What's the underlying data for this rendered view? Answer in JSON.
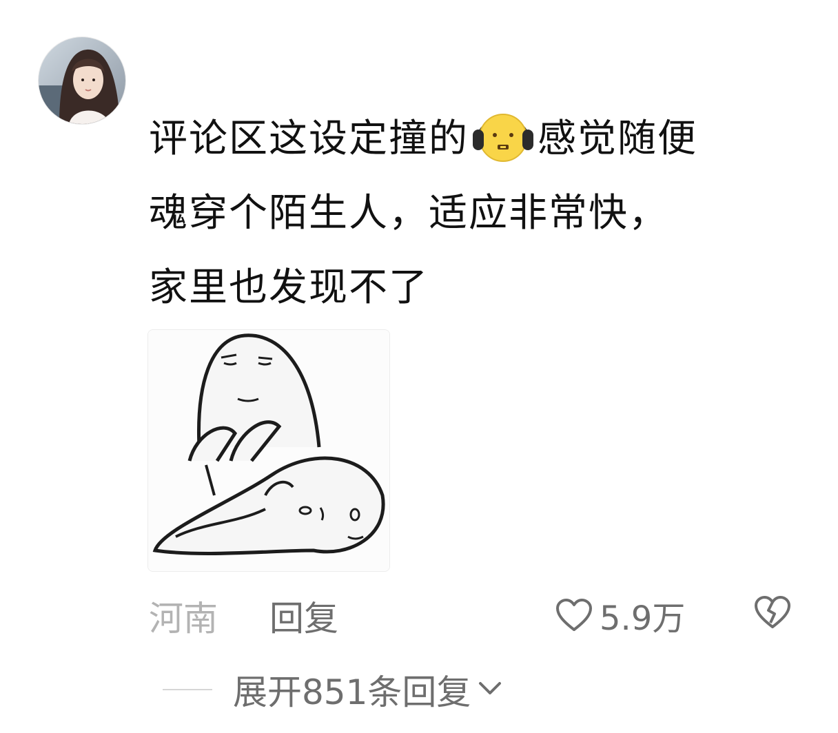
{
  "comment": {
    "avatar_icon": "user-avatar",
    "text": {
      "line1_before_emoji": "评论区这设定撞的",
      "emoji_icon": "headphones-grumpy-face-emoji",
      "line1_after_emoji": "感觉随便",
      "line2": "魂穿个陌生人，适应非常快，",
      "line3": "家里也发现不了"
    },
    "image_icon": "meme-sticker-image",
    "location": "河南",
    "reply_label": "回复",
    "like_icon": "heart-outline-icon",
    "like_count": "5.9万",
    "dislike_icon": "broken-heart-icon"
  },
  "expand_replies": {
    "label": "展开851条回复",
    "icon": "chevron-down-icon"
  },
  "colors": {
    "text_primary": "#111111",
    "text_secondary": "#6e6e6e",
    "text_muted": "#b3b3b3",
    "background": "#ffffff"
  }
}
